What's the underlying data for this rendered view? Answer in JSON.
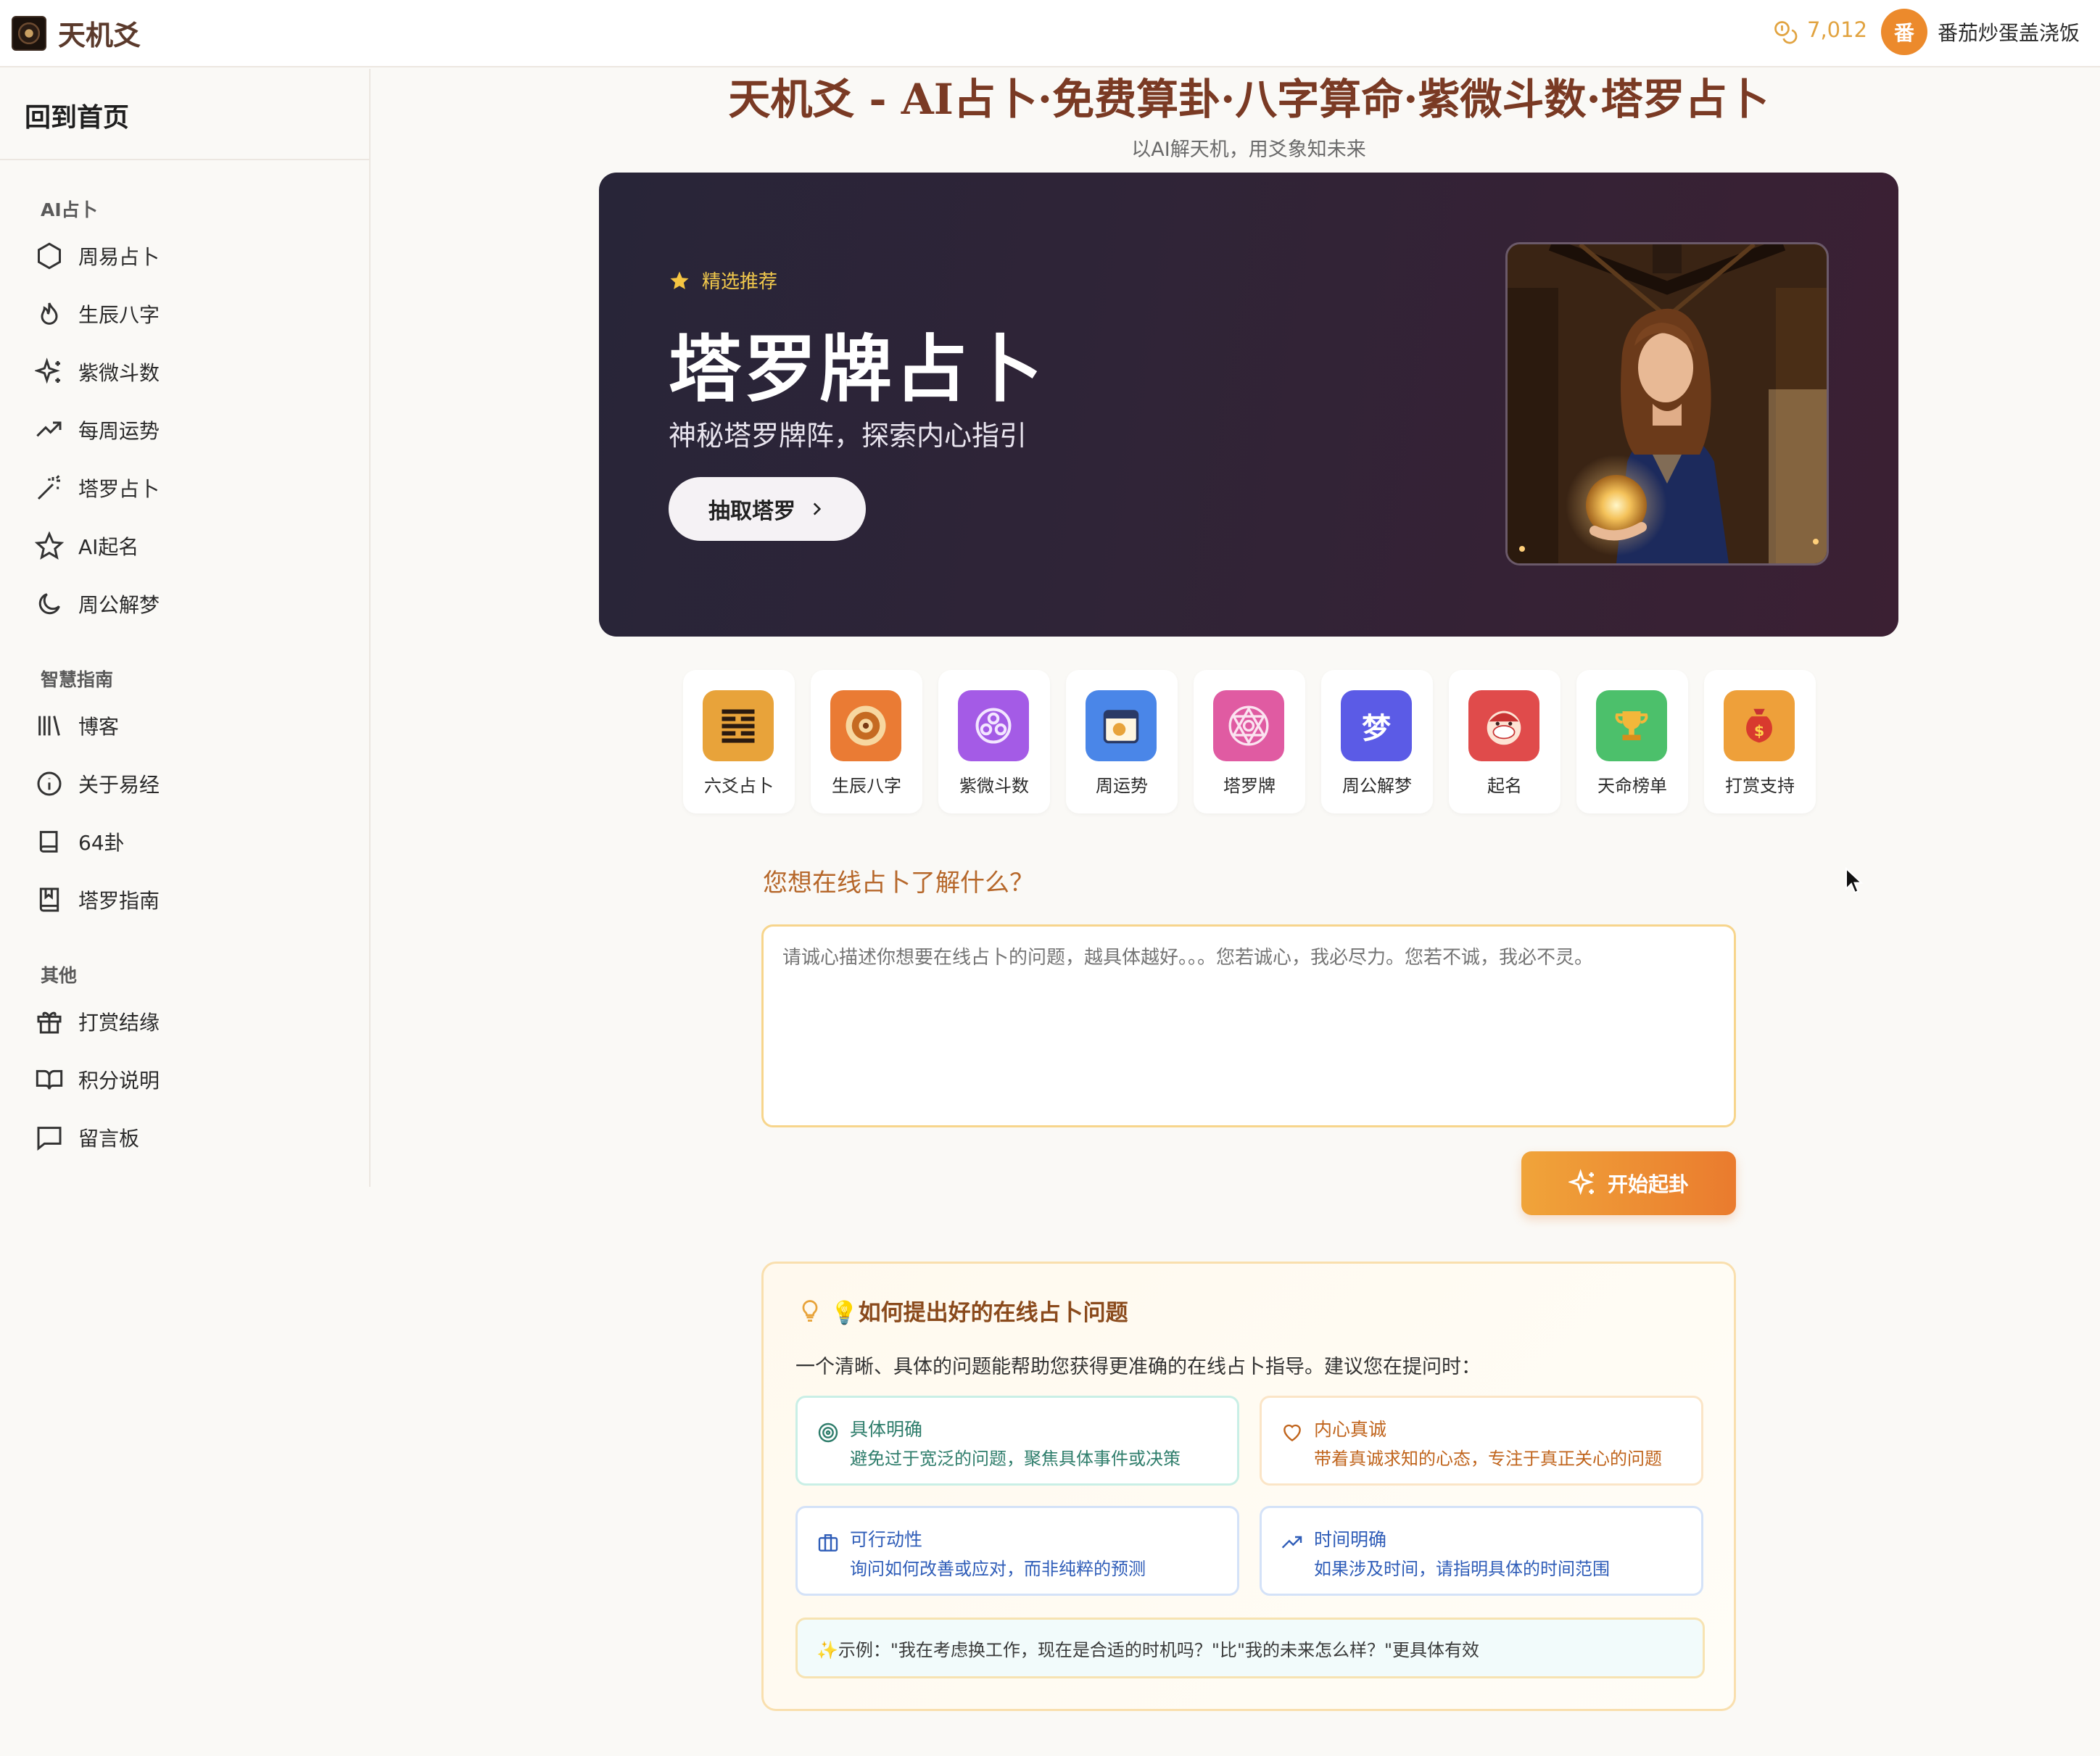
{
  "app": {
    "name": "天机爻"
  },
  "user": {
    "points": "7,012",
    "avatar_char": "番",
    "name": "番茄炒蛋盖浇饭"
  },
  "sidebar": {
    "home": "回到首页",
    "sections": [
      {
        "title": "AI占卜",
        "items": [
          {
            "label": "周易占卜",
            "icon": "hexagon-icon"
          },
          {
            "label": "生辰八字",
            "icon": "flame-icon"
          },
          {
            "label": "紫微斗数",
            "icon": "sparkles-icon"
          },
          {
            "label": "每周运势",
            "icon": "trending-up-icon"
          },
          {
            "label": "塔罗占卜",
            "icon": "magic-wand-icon"
          },
          {
            "label": "AI起名",
            "icon": "star-icon"
          },
          {
            "label": "周公解梦",
            "icon": "moon-icon"
          }
        ]
      },
      {
        "title": "智慧指南",
        "items": [
          {
            "label": "博客",
            "icon": "library-icon"
          },
          {
            "label": "关于易经",
            "icon": "info-icon"
          },
          {
            "label": "64卦",
            "icon": "book-icon"
          },
          {
            "label": "塔罗指南",
            "icon": "bookmark-book-icon"
          }
        ]
      },
      {
        "title": "其他",
        "items": [
          {
            "label": "打赏结缘",
            "icon": "gift-icon"
          },
          {
            "label": "积分说明",
            "icon": "open-book-icon"
          },
          {
            "label": "留言板",
            "icon": "message-icon"
          }
        ]
      }
    ]
  },
  "header": {
    "title": "天机爻 - AI占卜·免费算卦·八字算命·紫微斗数·塔罗占卜",
    "subtitle": "以AI解天机，用爻象知未来"
  },
  "hero": {
    "badge": "精选推荐",
    "title": "塔罗牌占卜",
    "subtitle": "神秘塔罗牌阵，探索内心指引",
    "button": "抽取塔罗"
  },
  "quick_links": [
    {
      "label": "六爻占卜",
      "color": "#e8a33a"
    },
    {
      "label": "生辰八字",
      "color": "#ea7b34"
    },
    {
      "label": "紫微斗数",
      "color": "#a45be6"
    },
    {
      "label": "周运势",
      "color": "#4a86e8"
    },
    {
      "label": "塔罗牌",
      "color": "#e05ba2"
    },
    {
      "label": "周公解梦",
      "color": "#5b5be6",
      "glyph": "梦"
    },
    {
      "label": "起名",
      "color": "#e04b4b"
    },
    {
      "label": "天命榜单",
      "color": "#4cc06b"
    },
    {
      "label": "打赏支持",
      "color": "#eea03a"
    }
  ],
  "question": {
    "label": "您想在线占卜了解什么？",
    "placeholder": "请诚心描述你想要在线占卜的问题，越具体越好。。。您若诚心，我必尽力。您若不诚，我必不灵。",
    "submit": "开始起卦"
  },
  "tips": {
    "title": "💡如何提出好的在线占卜问题",
    "desc": "一个清晰、具体的问题能帮助您获得更准确的在线占卜指导。建议您在提问时：",
    "cards": [
      {
        "title": "具体明确",
        "text": "避免过于宽泛的问题，聚焦具体事件或决策",
        "color": "#2e7d6b",
        "border": "#c9efe6"
      },
      {
        "title": "内心真诚",
        "text": "带着真诚求知的心态，专注于真正关心的问题",
        "color": "#c0641c",
        "border": "#fbe5c7"
      },
      {
        "title": "可行动性",
        "text": "询问如何改善或应对，而非纯粹的预测",
        "color": "#2f5db8",
        "border": "#d4e2f8"
      },
      {
        "title": "时间明确",
        "text": "如果涉及时间，请指明具体的时间范围",
        "color": "#2f5db8",
        "border": "#d4e2f8"
      }
    ],
    "example": "✨示例：\"我在考虑换工作，现在是合适的时机吗？\"比\"我的未来怎么样？\"更具体有效"
  }
}
